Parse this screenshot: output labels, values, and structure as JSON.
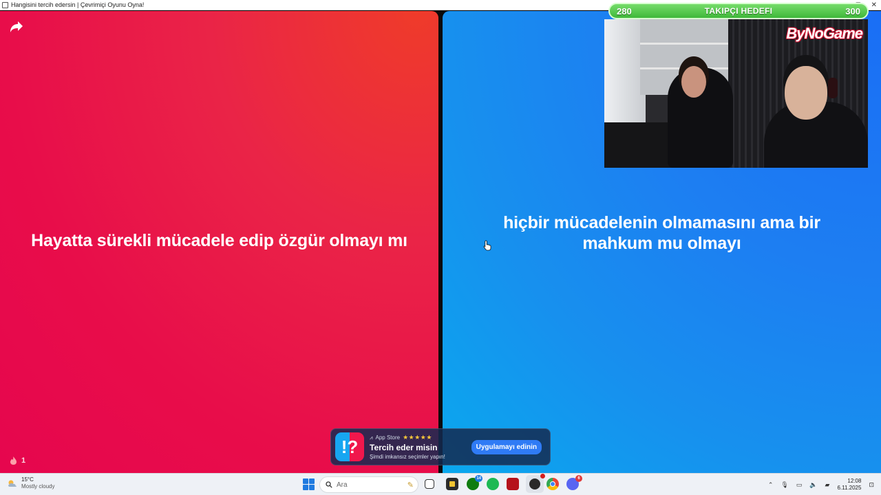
{
  "window": {
    "title": "Hangisini tercih edersin | Çevrimiçi Oyunu Oyna!",
    "controls": [
      "–",
      "▢",
      "✕"
    ]
  },
  "game": {
    "option_left": "Hayatta sürekli mücadele edip özgür olmayı mı",
    "option_right": "hiçbir mücadelenin olmamasını ama bir mahkum mu olmayı",
    "like_count": "1",
    "colors": {
      "left": "#e80d4a",
      "right": "#1d7ef2"
    }
  },
  "stream_overlay": {
    "goal_current": "280",
    "goal_title": "TAKIPÇI HEDEFI",
    "goal_target": "300",
    "logo": "ByNoGame"
  },
  "banner": {
    "store": "App Store",
    "stars": "★★★★★",
    "app_name": "Tercih eder misin",
    "tagline": "Şimdi imkansız seçimler yapın!",
    "cta": "Uygulamayı edinin",
    "logo_glyph": "!?"
  },
  "taskbar": {
    "weather_temp": "15°C",
    "weather_condition": "Mostly cloudy",
    "search_placeholder": "Ara",
    "xbox_badge": "14",
    "discord_badge": "6",
    "time": "12:08",
    "date": "6.11.2025"
  }
}
